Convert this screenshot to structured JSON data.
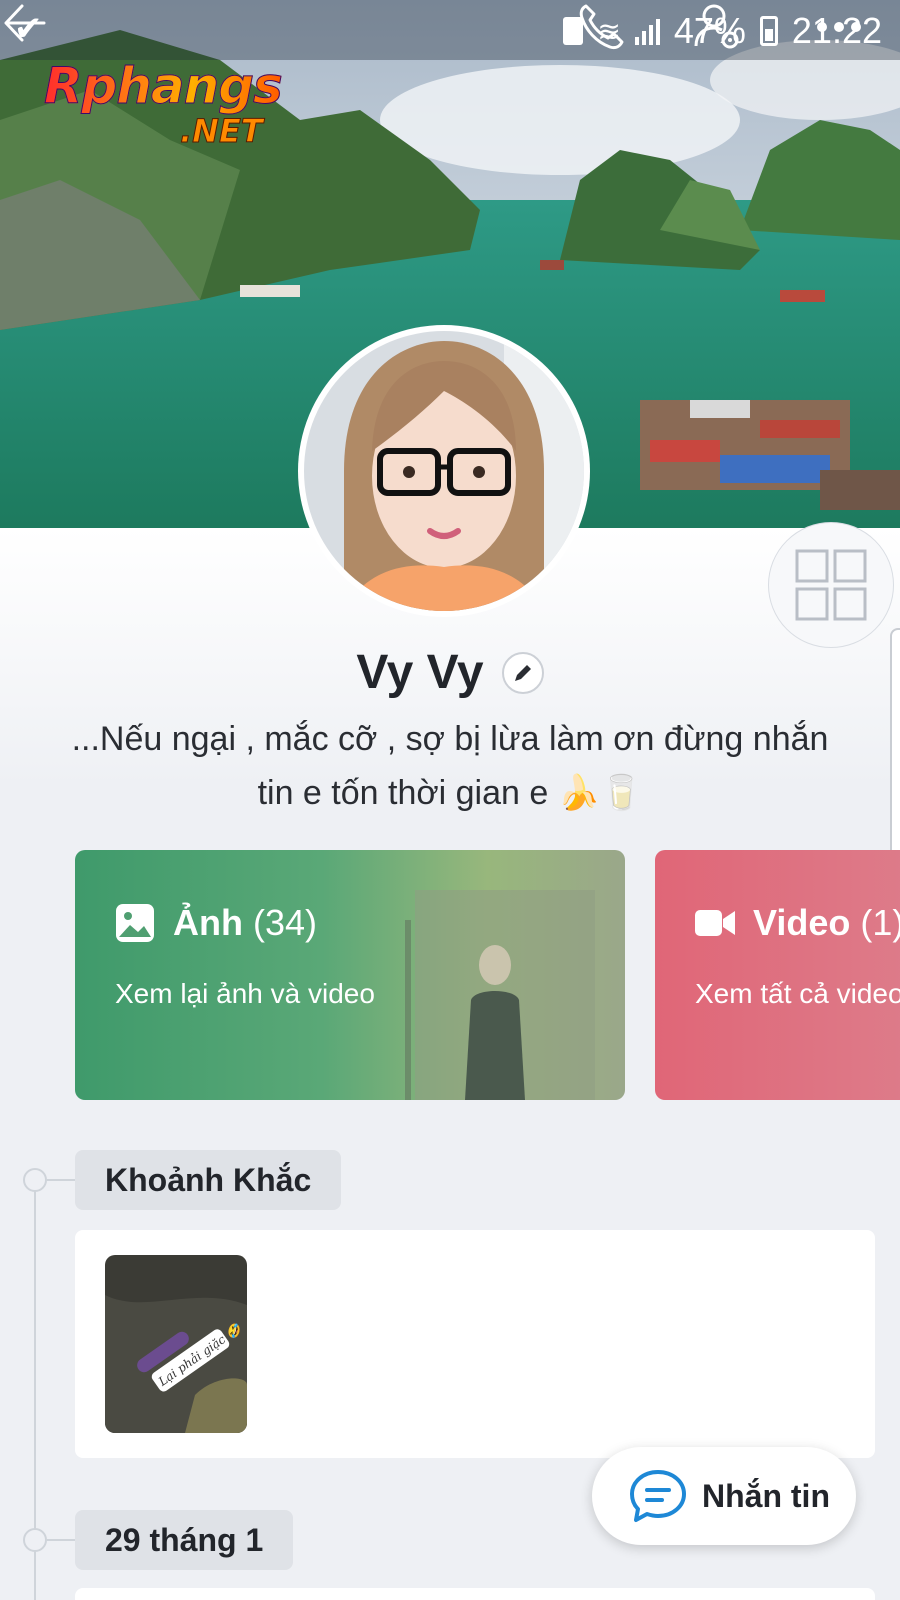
{
  "status_bar": {
    "battery": "47%",
    "time": "21:22"
  },
  "logo": {
    "line1": "Rphangs",
    "line2": ".NET"
  },
  "profile": {
    "name": "Vy Vy",
    "bio_line1": "...Nếu ngại , mắc cỡ , sợ bị lừa làm ơn đừng nhắn",
    "bio_line2": "tin e tốn thời gian e 🍌🥛"
  },
  "cards": {
    "photos": {
      "title": "Ảnh",
      "count": "(34)",
      "subtitle": "Xem lại ảnh và video"
    },
    "video": {
      "title": "Video",
      "count": "(1)",
      "subtitle": "Xem tất cả video"
    }
  },
  "timeline": {
    "moments_label": "Khoảnh Khắc",
    "thumb_sticker": "Lại phải giặc 🤣",
    "date_label": "29 tháng 1"
  },
  "message_button": {
    "label": "Nhắn tin"
  },
  "icons": {
    "back": "back-arrow-icon",
    "call": "phone-icon",
    "settings": "user-settings-icon",
    "more": "more-icon",
    "qr": "grid-icon",
    "edit": "pencil-icon",
    "chat": "chat-bubble-icon",
    "photo": "image-icon",
    "video": "video-camera-icon"
  },
  "colors": {
    "photos_card": "#3f9a6b",
    "video_card": "#e06677",
    "accent_blue": "#1e88d6"
  }
}
